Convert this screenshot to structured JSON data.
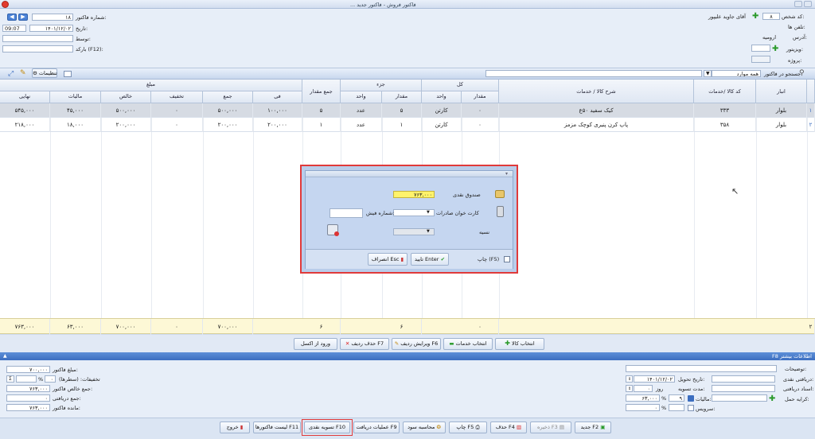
{
  "header": {
    "title_partial": "... فاکتور فروش - فاکتور جدید"
  },
  "customer": {
    "code_label": "کد شخص:",
    "code_value": "۸",
    "name": "آقای جاوید علیپور",
    "phone_label": "تلفن ها:",
    "address_label": "آدرس:",
    "address_value": "ارومیه",
    "visitor_label": "ویزیتور:",
    "project_label": "پروژه:"
  },
  "invoice": {
    "number_label": "شماره فاکتور:",
    "number_value": "۱۸",
    "date_label": "تاریخ:",
    "date_value": "۱۴۰۱/۱۲/۰۲",
    "time_value": "09:07",
    "by_label": "توسط:",
    "barcode_label": "بارکد (F12):"
  },
  "toolbar": {
    "search_label": "جستجو در فاکتور",
    "search_value": "همه موارد",
    "settings_label": "تنظیمات"
  },
  "grid": {
    "group_headers": {
      "kol": "کل",
      "joz": "جزء",
      "mablagh": "مبلغ"
    },
    "headers": {
      "anbar": "انبار",
      "code": "کد کالا /خدمات",
      "desc": "شرح کالا / خدمات",
      "kol_meqdar": "مقدار",
      "kol_vahed": "واحد",
      "joz_meqdar": "مقدار",
      "joz_vahed": "واحد",
      "sum_meqdar": "جمع مقدار",
      "fi": "فی",
      "jam": "جمع",
      "takhfif": "تخفیف",
      "khales": "خالص",
      "maliat": "مالیات",
      "nahaee": "نهایی"
    },
    "rows": [
      {
        "num": "۱",
        "anbar": "بلوار",
        "code": "۳۳۳",
        "desc": "کیک سفید ۵۰ع",
        "kol_meqdar": "۰",
        "kol_vahed": "کارتن",
        "joz_meqdar": "۵",
        "joz_vahed": "عدد",
        "sum_meqdar": "۵",
        "fi": "۱۰۰,۰۰۰",
        "jam": "۵۰۰,۰۰۰",
        "takhfif": "۰",
        "khales": "۵۰۰,۰۰۰",
        "maliat": "۴۵,۰۰۰",
        "nahaee": "۵۴۵,۰۰۰"
      },
      {
        "num": "۲",
        "anbar": "بلوار",
        "code": "۳۵۸",
        "desc": "پاپ کرن پنیری کوچک مزمز",
        "kol_meqdar": "۰",
        "kol_vahed": "کارتن",
        "joz_meqdar": "۱",
        "joz_vahed": "عدد",
        "sum_meqdar": "۱",
        "fi": "۲۰۰,۰۰۰",
        "jam": "۲۰۰,۰۰۰",
        "takhfif": "۰",
        "khales": "۲۰۰,۰۰۰",
        "maliat": "۱۸,۰۰۰",
        "nahaee": "۲۱۸,۰۰۰"
      }
    ],
    "totals": {
      "num": "۲",
      "kol_meqdar": "۰",
      "joz_meqdar": "۶",
      "sum_meqdar": "۶",
      "jam": "۷۰۰,۰۰۰",
      "takhfif": "۰",
      "khales": "۷۰۰,۰۰۰",
      "maliat": "۶۳,۰۰۰",
      "nahaee": "۷۶۳,۰۰۰"
    }
  },
  "actions": {
    "select_goods": "انتخاب کالا",
    "select_service": "انتخاب خدمات",
    "edit_row": "ویرایش ردیف F6",
    "delete_row": "حذف ردیف F7",
    "excel_import": "ورود از اکسل"
  },
  "section_bar": {
    "more_info": "F8 اطلاعات بیشتر"
  },
  "bottom_left": {
    "invoice_amount_label": "مبلغ فاکتور:",
    "invoice_amount_value": "۷۰۰,۰۰۰",
    "discount_label": "تخفیفات: (سطرها)",
    "discount_value": "۰",
    "discount_pct": "%",
    "net_label": "جمع خالص فاکتور:",
    "net_value": "۷۶۳,۰۰۰",
    "received_label": "جمع دریافتی:",
    "received_value": "۰",
    "remaining_label": "مانده فاکتور:",
    "remaining_value": "۷۶۳,۰۰۰"
  },
  "bottom_right": {
    "notes_label": "توضیحات:",
    "cash_received_label": "دریافتی نقدی:",
    "delivery_date_label": "تاریخ تحویل:",
    "delivery_date_value": "۱۴۰۱/۱۲/۰۲",
    "received_docs_label": "اسناد دریافتی:",
    "settle_period_label": "مدت تسویه:",
    "settle_period_unit": "روز",
    "settle_period_value": "۰",
    "shipping_label": "کرایه حمل:",
    "tax_label": "مالیات:",
    "tax_pct": "۹",
    "tax_value": "۶۳,۰۰۰",
    "service_label": "سرویس:",
    "service_value": "۰"
  },
  "status_buttons": {
    "new": "جدید F2",
    "save": "ذخیره F3",
    "delete": "حذف F4",
    "print": "چاپ F5",
    "profit": "محاسبه سود",
    "receipts": "عملیات دریافت F9",
    "cash_settle": "تسویه نقدی F10",
    "invoice_list": "لیست فاکتورها F11",
    "exit": "خروج"
  },
  "dialog": {
    "cash_box_label": "صندوق نقدی",
    "cash_box_value": "۷۶۳,۰۰۰",
    "card_reader_label": "کارت خوان صادرات",
    "receipt_number_label": "شماره فیش:",
    "credit_label": "نسیه",
    "print_label": "چاپ (F5)",
    "confirm_label": "تایید Enter",
    "cancel_label": "انصراف Esc"
  },
  "colors": {
    "selection_outline": "#e03a3a",
    "cash_field": "#fff36b",
    "accent_blue": "#3c6ec0"
  }
}
